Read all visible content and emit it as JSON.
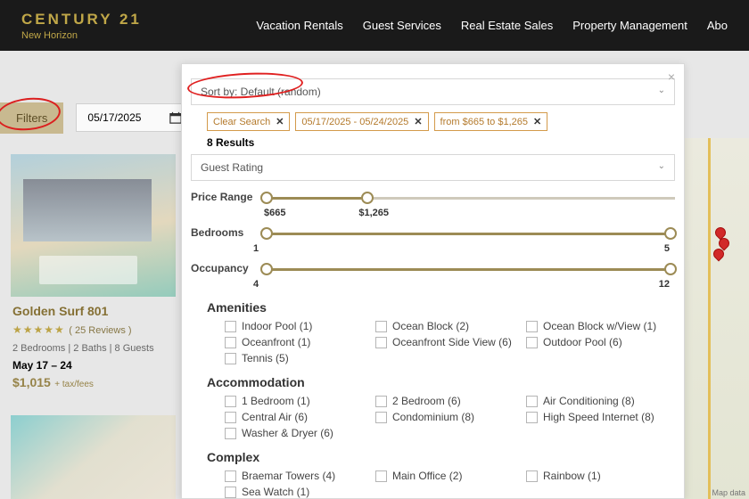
{
  "header": {
    "brand_main": "CENTURY 21",
    "brand_sub": "New Horizon",
    "nav": [
      "Vacation Rentals",
      "Guest Services",
      "Real Estate Sales",
      "Property Management",
      "Abo"
    ]
  },
  "filters_bar": {
    "filters_label": "Filters",
    "date": "05/17/2025"
  },
  "listing1": {
    "title": "Golden Surf 801",
    "stars": "★★★★★",
    "reviews": "( 25 Reviews )",
    "meta": "2 Bedrooms | 2 Baths | 8 Guests",
    "dates": "May 17 – 24",
    "price": "$1,015",
    "price_note": "+ tax/fees"
  },
  "panel": {
    "sort_label": "Sort by: Default (random)",
    "chips": [
      {
        "label": "Clear Search"
      },
      {
        "label": "05/17/2025 - 05/24/2025"
      },
      {
        "label": "from $665 to $1,265"
      }
    ],
    "results": "8 Results",
    "guest_rating_label": "Guest Rating",
    "price_range": {
      "label": "Price Range",
      "min": "$665",
      "max": "$1,265"
    },
    "bedrooms": {
      "label": "Bedrooms",
      "min": "1",
      "max": "5"
    },
    "occupancy": {
      "label": "Occupancy",
      "min": "4",
      "max": "12"
    },
    "amenities_h": "Amenities",
    "amenities": [
      "Indoor Pool (1)",
      "Ocean Block (2)",
      "Ocean Block w/View (1)",
      "Oceanfront (1)",
      "Oceanfront Side View (6)",
      "Outdoor Pool (6)",
      "Tennis (5)"
    ],
    "accommodation_h": "Accommodation",
    "accommodation": [
      "1 Bedroom (1)",
      "2 Bedroom (6)",
      "Air Conditioning (8)",
      "Central Air (6)",
      "Condominium (8)",
      "High Speed Internet (8)",
      "Washer & Dryer (6)"
    ],
    "complex_h": "Complex",
    "complex": [
      "Braemar Towers (4)",
      "Main Office (2)",
      "Rainbow (1)",
      "Sea Watch (1)"
    ]
  },
  "map": {
    "attribution": "Map data"
  }
}
